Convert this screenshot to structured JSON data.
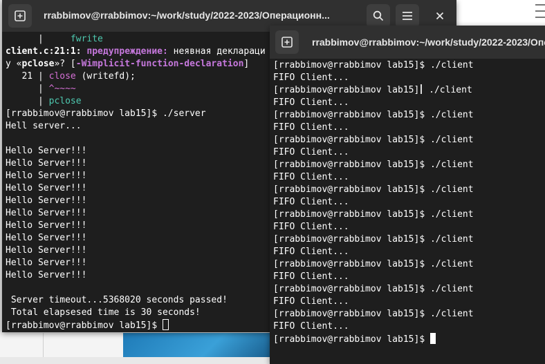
{
  "left_window": {
    "title": "rrabbimov@rrabbimov:~/work/study/2022-2023/Операционн...",
    "lines": [
      {
        "segments": [
          {
            "t": "      |     ",
            "c": ""
          },
          {
            "t": "fwrite",
            "c": "green"
          }
        ]
      },
      {
        "segments": [
          {
            "t": "client.c:21:1: ",
            "c": "bold"
          },
          {
            "t": "предупреждение: ",
            "c": "purple"
          },
          {
            "t": "неявная деклараци",
            "c": ""
          }
        ]
      },
      {
        "segments": [
          {
            "t": "у «",
            "c": ""
          },
          {
            "t": "pclose",
            "c": "bold"
          },
          {
            "t": "»? [",
            "c": ""
          },
          {
            "t": "-Wimplicit-function-declaration",
            "c": "purple"
          },
          {
            "t": "]",
            "c": ""
          }
        ]
      },
      {
        "segments": [
          {
            "t": "   21 | ",
            "c": ""
          },
          {
            "t": "close",
            "c": "magenta"
          },
          {
            "t": " (writefd);",
            "c": ""
          }
        ]
      },
      {
        "segments": [
          {
            "t": "      | ",
            "c": ""
          },
          {
            "t": "^~~~~",
            "c": "magenta"
          }
        ]
      },
      {
        "segments": [
          {
            "t": "      | ",
            "c": ""
          },
          {
            "t": "pclose",
            "c": "green"
          }
        ]
      },
      {
        "segments": [
          {
            "t": "[rrabbimov@rrabbimov lab15]$ ./server",
            "c": ""
          }
        ]
      },
      {
        "segments": [
          {
            "t": "Hell server...",
            "c": ""
          }
        ]
      },
      {
        "segments": [
          {
            "t": "",
            "c": ""
          }
        ]
      },
      {
        "segments": [
          {
            "t": "Hello Server!!!",
            "c": ""
          }
        ]
      },
      {
        "segments": [
          {
            "t": "Hello Server!!!",
            "c": ""
          }
        ]
      },
      {
        "segments": [
          {
            "t": "Hello Server!!!",
            "c": ""
          }
        ]
      },
      {
        "segments": [
          {
            "t": "Hello Server!!!",
            "c": ""
          }
        ]
      },
      {
        "segments": [
          {
            "t": "Hello Server!!!",
            "c": ""
          }
        ]
      },
      {
        "segments": [
          {
            "t": "Hello Server!!!",
            "c": ""
          }
        ]
      },
      {
        "segments": [
          {
            "t": "Hello Server!!!",
            "c": ""
          }
        ]
      },
      {
        "segments": [
          {
            "t": "Hello Server!!!",
            "c": ""
          }
        ]
      },
      {
        "segments": [
          {
            "t": "Hello Server!!!",
            "c": ""
          }
        ]
      },
      {
        "segments": [
          {
            "t": "Hello Server!!!",
            "c": ""
          }
        ]
      },
      {
        "segments": [
          {
            "t": "Hello Server!!!",
            "c": ""
          }
        ]
      },
      {
        "segments": [
          {
            "t": "",
            "c": ""
          }
        ]
      },
      {
        "segments": [
          {
            "t": " Server timeout...5368020 seconds passed!",
            "c": ""
          }
        ]
      },
      {
        "segments": [
          {
            "t": " Total elapsesed time is 30 seconds!",
            "c": ""
          }
        ]
      }
    ],
    "prompt": "[rrabbimov@rrabbimov lab15]$ "
  },
  "right_window": {
    "title": "rrabbimov@rrabbimov:~/work/study/2022-2023/Операци",
    "lines": [
      "[rrabbimov@rrabbimov lab15]$ ./client",
      "FIFO Client...",
      "[rrabbimov@rrabbimov lab15]$ ./client",
      "FIFO Client...",
      "[rrabbimov@rrabbimov lab15]$ ./client",
      "FIFO Client...",
      "[rrabbimov@rrabbimov lab15]$ ./client",
      "FIFO Client...",
      "[rrabbimov@rrabbimov lab15]$ ./client",
      "FIFO Client...",
      "[rrabbimov@rrabbimov lab15]$ ./client",
      "FIFO Client...",
      "[rrabbimov@rrabbimov lab15]$ ./client",
      "FIFO Client...",
      "[rrabbimov@rrabbimov lab15]$ ./client",
      "FIFO Client...",
      "[rrabbimov@rrabbimov lab15]$ ./client",
      "FIFO Client...",
      "[rrabbimov@rrabbimov lab15]$ ./client",
      "FIFO Client...",
      "[rrabbimov@rrabbimov lab15]$ ./client",
      "FIFO Client..."
    ],
    "prompt": "[rrabbimov@rrabbimov lab15]$ "
  },
  "icons": {
    "new_tab": "plus-square-icon",
    "search": "search-icon",
    "menu": "hamburger-menu-icon",
    "close": "close-icon"
  },
  "colors": {
    "terminal_bg": "#1e1e1e",
    "titlebar_bg": "#303030",
    "warning_purple": "#c678dd",
    "hint_green": "#4ec9b0",
    "error_magenta": "#d670d6"
  }
}
